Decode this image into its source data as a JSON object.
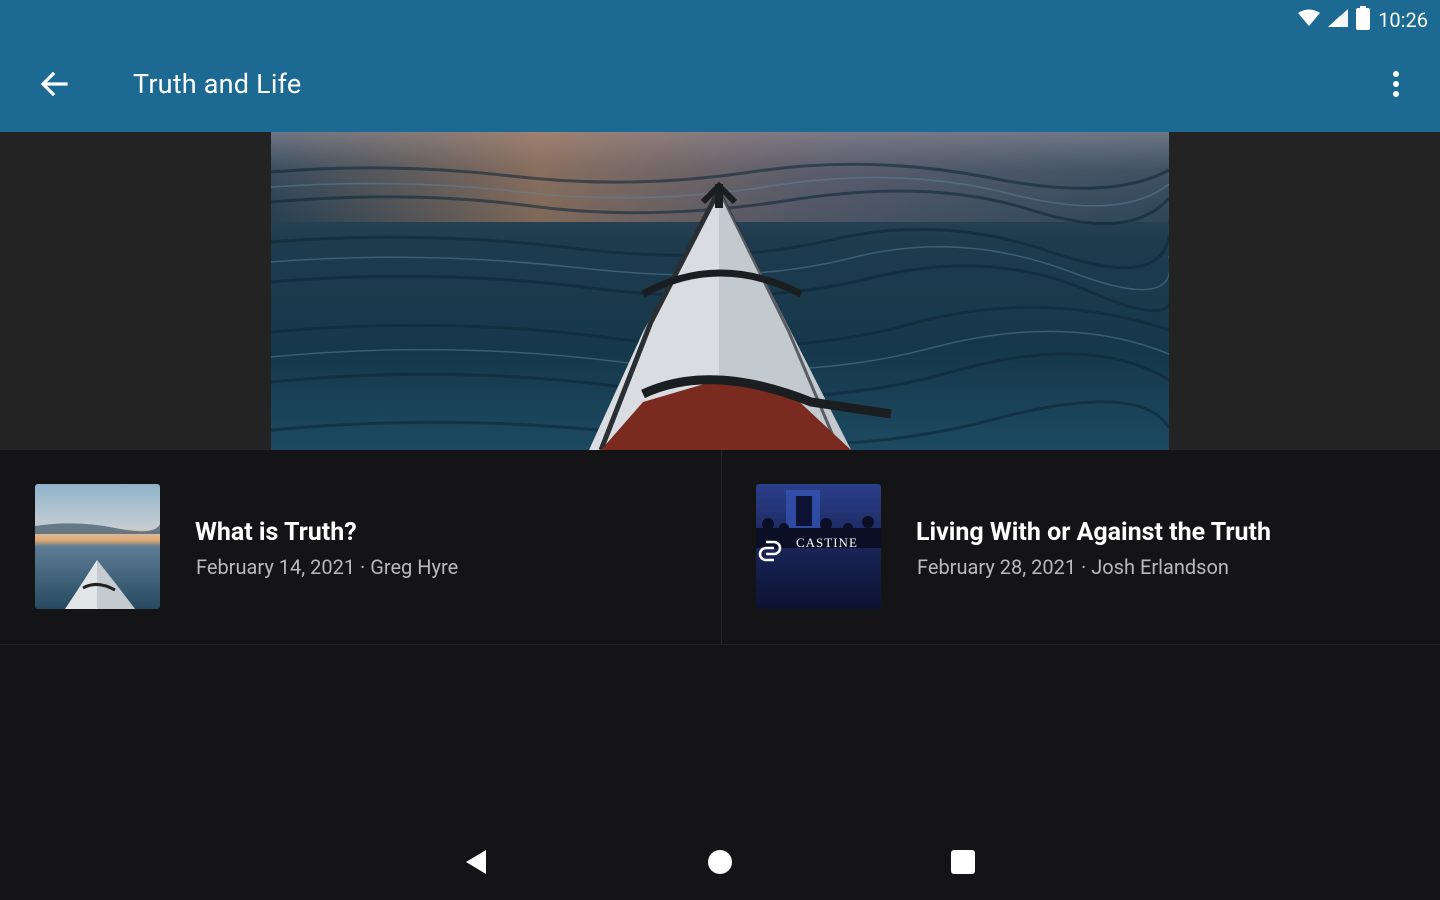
{
  "status_bar": {
    "time": "10:26",
    "icons": [
      "wifi-icon",
      "signal-icon",
      "battery-icon"
    ]
  },
  "app_bar": {
    "title": "Truth and Life",
    "back_icon": "arrow-back-icon",
    "menu_icon": "more-vert-icon",
    "color": "#1c6a93"
  },
  "hero": {
    "image": "kayak-bow-on-water"
  },
  "series_items": [
    {
      "title": "What is Truth?",
      "meta": "February 14, 2021 · Greg Hyre",
      "thumbnail": "kayak-thumbnail"
    },
    {
      "title": "Living With or Against the Truth",
      "meta": "February 28, 2021 · Josh Erlandson",
      "thumbnail": "castine-church-thumbnail",
      "thumbnail_text": "CASTINE"
    }
  ],
  "nav_bar": {
    "icons": [
      "back-triangle-icon",
      "home-circle-icon",
      "recents-square-icon"
    ]
  },
  "colors": {
    "background": "#141416",
    "hero_side": "#232323",
    "meta_text": "#b9b9bc"
  }
}
